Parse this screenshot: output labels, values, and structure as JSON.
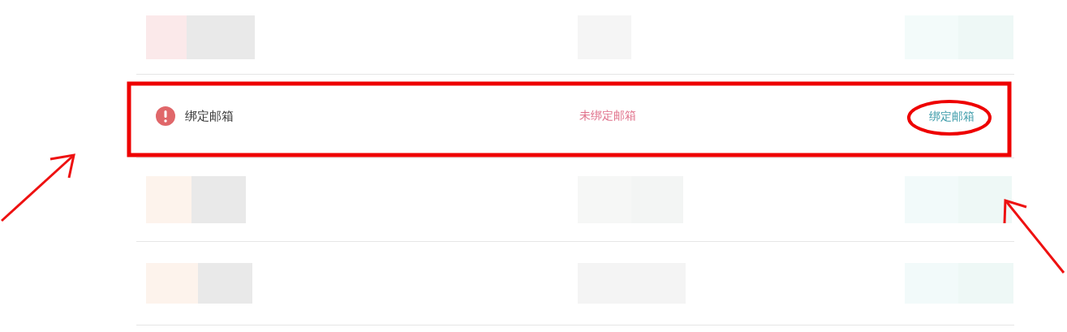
{
  "rows": [
    {
      "kind": "redacted"
    },
    {
      "kind": "setting",
      "label": "绑定邮箱",
      "status": "未绑定邮箱",
      "action": "绑定邮箱",
      "bound": false
    },
    {
      "kind": "redacted"
    },
    {
      "kind": "redacted"
    }
  ]
}
